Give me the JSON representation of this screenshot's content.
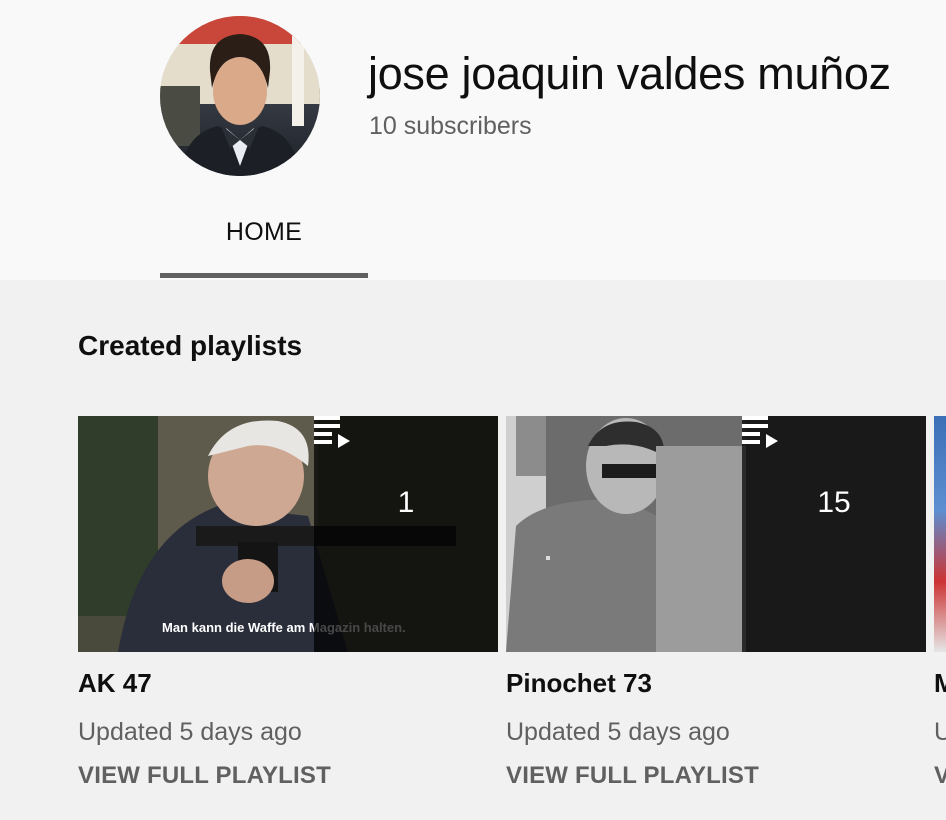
{
  "channel": {
    "name": "jose joaquin valdes muñoz",
    "subscribers": "10 subscribers",
    "avatar_icon": "avatar-photo"
  },
  "tabs": [
    {
      "label": "HOME",
      "selected": true
    }
  ],
  "shelf": {
    "title": "Created playlists",
    "playlists": [
      {
        "title": "AK 47",
        "video_count": "1",
        "updated": "Updated 5 days ago",
        "link": "VIEW FULL PLAYLIST",
        "thumbnail_caption": "Man kann die Waffe am Magazin halten.",
        "icon": "playlist-play-icon"
      },
      {
        "title": "Pinochet 73",
        "video_count": "15",
        "updated": "Updated 5 days ago",
        "link": "VIEW FULL PLAYLIST",
        "icon": "playlist-play-icon"
      },
      {
        "title": "M",
        "updated": "U",
        "link": "V"
      }
    ]
  },
  "colors": {
    "header_bg": "#f9f9f9",
    "page_bg": "#f1f1f1",
    "primary_text": "#0f0f0f",
    "secondary_text": "#606060",
    "overlay": "#000000"
  }
}
